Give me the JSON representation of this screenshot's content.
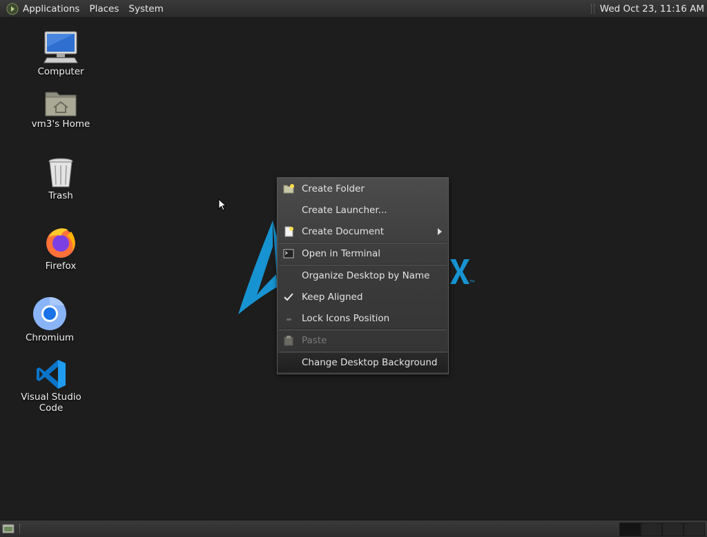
{
  "top_panel": {
    "menus": [
      "Applications",
      "Places",
      "System"
    ],
    "clock": "Wed Oct 23, 11:16 AM"
  },
  "desktop_icons": [
    {
      "label": "Computer",
      "icon": "computer-icon"
    },
    {
      "label": "vm3's Home",
      "icon": "home-folder-icon"
    },
    {
      "label": "Trash",
      "icon": "trash-icon"
    },
    {
      "label": "Firefox",
      "icon": "firefox-icon"
    },
    {
      "label": "Chromium",
      "icon": "chromium-icon"
    },
    {
      "label": "Visual Studio Code",
      "icon": "vscode-icon"
    }
  ],
  "context_menu": {
    "items": [
      {
        "label": "Create Folder",
        "icon": "new-folder-icon"
      },
      {
        "label": "Create Launcher...",
        "icon": ""
      },
      {
        "label": "Create Document",
        "icon": "new-document-icon",
        "submenu": true
      },
      {
        "label": "Open in Terminal",
        "icon": "terminal-icon"
      },
      {
        "label": "Organize Desktop by Name",
        "icon": ""
      },
      {
        "label": "Keep Aligned",
        "icon": "checkmark-icon",
        "checked": true
      },
      {
        "label": "Lock Icons Position",
        "icon": "lock-toggle-icon"
      },
      {
        "label": "Paste",
        "icon": "paste-icon",
        "disabled": true
      },
      {
        "label": "Change Desktop Background",
        "icon": "",
        "highlighted": true
      }
    ]
  },
  "colors": {
    "desktop_bg": "#1d1d1d",
    "logo_blue": "#1793d1",
    "panel_bg": "#2e2e2e"
  }
}
